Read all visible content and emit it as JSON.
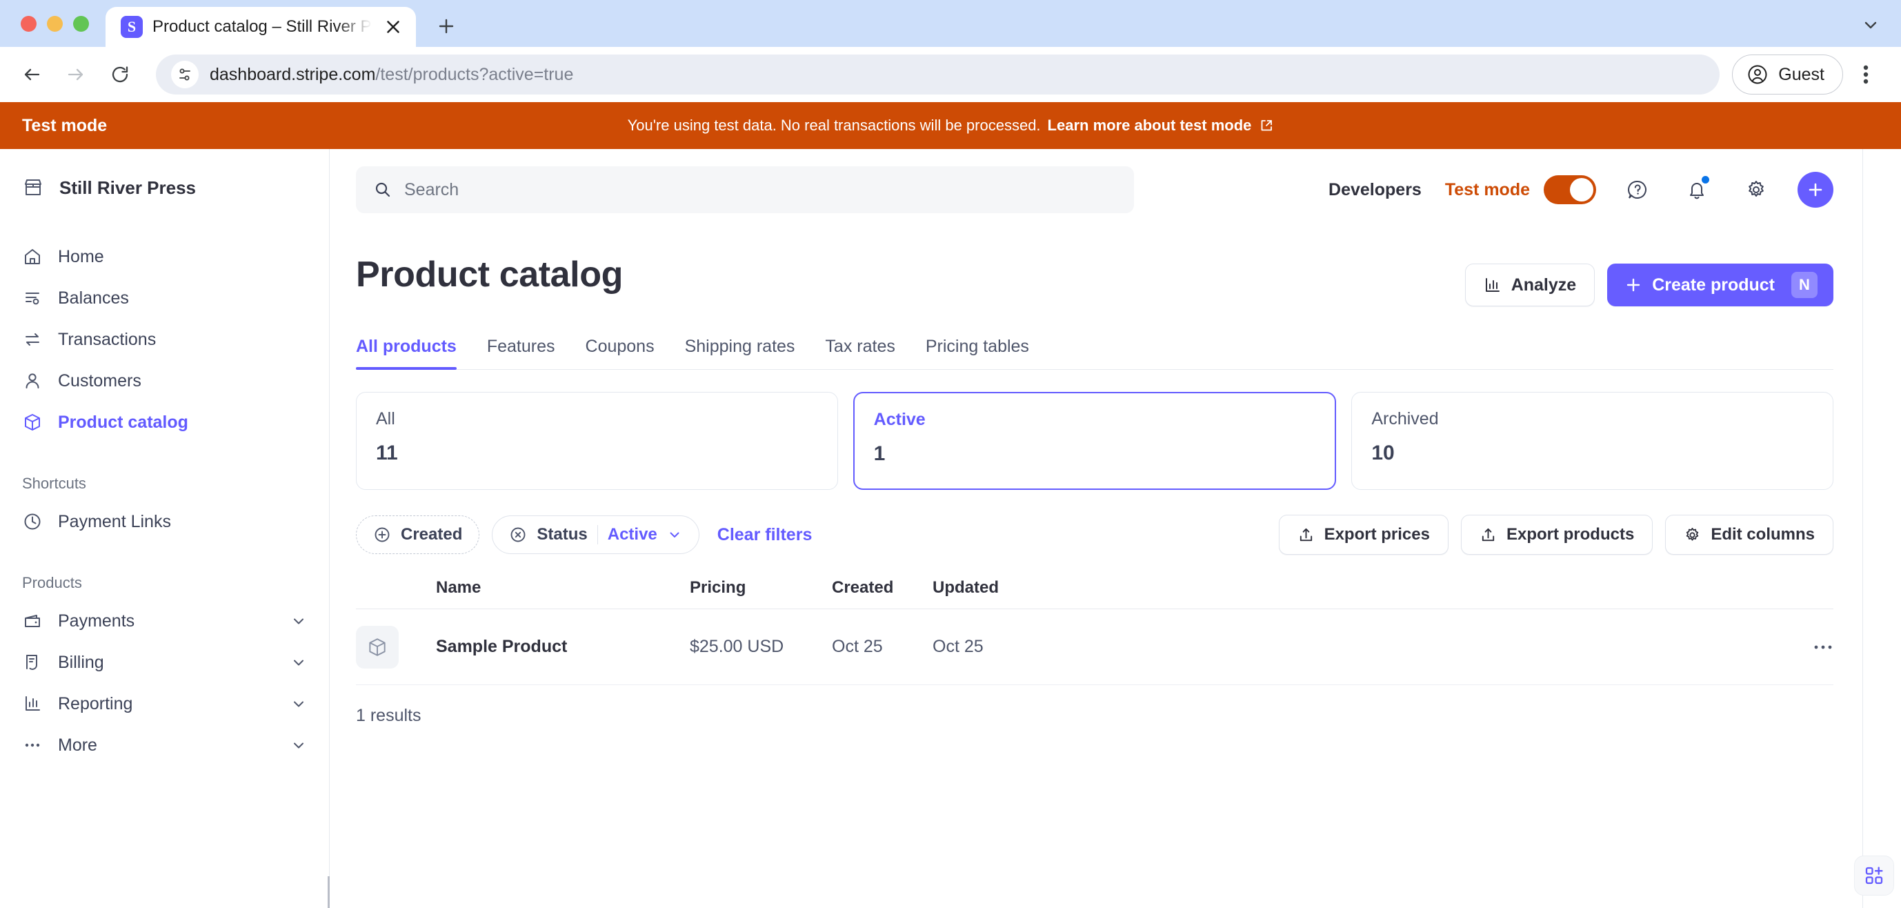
{
  "browser": {
    "tab": {
      "title": "Product catalog – Still River Press",
      "favicon_letter": "S",
      "close_icon": "close-icon"
    },
    "new_tab_label": "+",
    "url_host": "dashboard.stripe.com",
    "url_path": "/test/products?active=true",
    "profile_label": "Guest",
    "back_icon": "back-arrow-icon",
    "forward_icon": "forward-arrow-icon",
    "reload_icon": "reload-icon",
    "site_info_icon": "site-settings-icon",
    "menu_icon": "kebab-menu-icon"
  },
  "test_banner": {
    "left_label": "Test mode",
    "message": "You're using test data. No real transactions will be processed.",
    "link_label": "Learn more about test mode",
    "background": "#cd4b05"
  },
  "sidebar": {
    "account_name": "Still River Press",
    "nav": [
      {
        "label": "Home",
        "icon": "home-icon",
        "active": false
      },
      {
        "label": "Balances",
        "icon": "balances-icon",
        "active": false
      },
      {
        "label": "Transactions",
        "icon": "transactions-icon",
        "active": false
      },
      {
        "label": "Customers",
        "icon": "customers-icon",
        "active": false
      },
      {
        "label": "Product catalog",
        "icon": "product-catalog-icon",
        "active": true
      }
    ],
    "shortcuts_label": "Shortcuts",
    "shortcuts": [
      {
        "label": "Payment Links",
        "icon": "clock-icon"
      }
    ],
    "products_label": "Products",
    "products": [
      {
        "label": "Payments",
        "icon": "wallet-icon"
      },
      {
        "label": "Billing",
        "icon": "billing-icon"
      },
      {
        "label": "Reporting",
        "icon": "reporting-icon"
      },
      {
        "label": "More",
        "icon": "ellipsis-icon"
      }
    ]
  },
  "appbar": {
    "search_placeholder": "Search",
    "developers_label": "Developers",
    "test_mode_label": "Test mode",
    "test_mode_on": true,
    "help_icon": "help-icon",
    "notifications_icon": "bell-icon",
    "settings_icon": "gear-icon",
    "create_icon": "plus-icon"
  },
  "page": {
    "title": "Product catalog",
    "analyze_label": "Analyze",
    "create_label": "Create product",
    "create_shortcut": "N",
    "tabs": [
      {
        "label": "All products",
        "active": true
      },
      {
        "label": "Features",
        "active": false
      },
      {
        "label": "Coupons",
        "active": false
      },
      {
        "label": "Shipping rates",
        "active": false
      },
      {
        "label": "Tax rates",
        "active": false
      },
      {
        "label": "Pricing tables",
        "active": false
      }
    ],
    "cards": [
      {
        "label": "All",
        "value": "11",
        "selected": false
      },
      {
        "label": "Active",
        "value": "1",
        "selected": true
      },
      {
        "label": "Archived",
        "value": "10",
        "selected": false
      }
    ],
    "filters": {
      "created_label": "Created",
      "status_label": "Status",
      "status_value": "Active",
      "clear_label": "Clear filters"
    },
    "actions": {
      "export_prices": "Export prices",
      "export_products": "Export products",
      "edit_columns": "Edit columns"
    },
    "table": {
      "columns": [
        "Name",
        "Pricing",
        "Created",
        "Updated"
      ],
      "rows": [
        {
          "name": "Sample Product",
          "pricing": "$25.00 USD",
          "created": "Oct 25",
          "updated": "Oct 25",
          "thumb_icon": "product-box-icon",
          "menu_icon": "row-overflow-icon"
        }
      ],
      "results_label": "1 results"
    },
    "app_widget_icon": "add-apps-icon"
  },
  "colors": {
    "accent": "#635bff",
    "test_mode": "#cd4b05",
    "text": "#30313d",
    "muted": "#4f566b"
  }
}
